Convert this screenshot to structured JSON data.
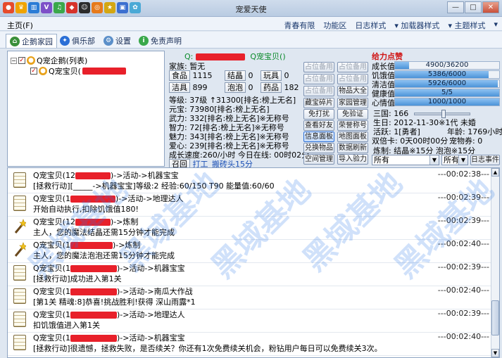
{
  "window": {
    "title": "宠爱天使",
    "controls": [
      "—",
      "□",
      "✕"
    ]
  },
  "menu": {
    "home": "主页(F)",
    "right": [
      "青春有限",
      "功能区",
      "日志样式",
      "▾ 加载器样式",
      "▾ 主题样式",
      "▾"
    ]
  },
  "tabs": [
    {
      "label": "企鹅家园",
      "icon": "home-icon"
    },
    {
      "label": "俱乐部",
      "icon": "club-icon"
    },
    {
      "label": "设置",
      "icon": "gear-icon"
    },
    {
      "label": "免责声明",
      "icon": "info-icon"
    }
  ],
  "tree": {
    "root_label": "Q宠企鹅(列表)",
    "child_label": "Q宠宝贝("
  },
  "pet": {
    "header_q": "Q:",
    "header_pet": "Q宠宝贝()",
    "family_label": "家族:",
    "family_value": "暂无",
    "food_label": "食品",
    "food_value": "1115",
    "crystal_label": "结晶",
    "crystal_value": "0",
    "toy_label": "玩具",
    "toy_value": "0",
    "clean_label": "洁具",
    "clean_value": "899",
    "bubble_label": "泡泡",
    "bubble_value": "0",
    "medicine_label": "药品",
    "medicine_value": "182",
    "level": "等级: 37级 ↑31300[排名:榜上无名]",
    "yuanbao": "元宝: 73980[排名:榜上无名]",
    "force": "武力: 332[排名:榜上无名]※无称号",
    "wisdom": "智力: 72[排名:榜上无名]※无称号",
    "charm": "魅力: 343[排名:榜上无名]※无称号",
    "love": "爱心: 239[排名:榜上无名]※无称号",
    "growth_speed": "成长速度:260/小时   今日在线: 00时02分",
    "recall_label": "召回",
    "work_link": "打工_搬砖头15分"
  },
  "buttons": [
    [
      "占位备用",
      "占位备用"
    ],
    [
      "占位备用",
      "占位备用"
    ],
    [
      "占位备用",
      "物品大全"
    ],
    [
      "藏宝碎片",
      "家园管理"
    ],
    [
      "免打扰",
      "免验证"
    ],
    [
      "查看好友",
      "荣誉称号"
    ],
    [
      "信息面板",
      "地图面板"
    ],
    [
      "兑换物品",
      "数据刷新"
    ],
    [
      "空间管理",
      "导入验力"
    ]
  ],
  "stats": {
    "title": "给力点赞",
    "bars": [
      {
        "label": "成长值",
        "text": "4900/36200",
        "fraction": 0.135
      },
      {
        "label": "饥饿值",
        "text": "5386/6000",
        "fraction": 0.898
      },
      {
        "label": "清洁值",
        "text": "5926/6000",
        "fraction": 0.988
      },
      {
        "label": "健康值",
        "text": "5/5",
        "fraction": 1.0
      },
      {
        "label": "心情值",
        "text": "1000/1000",
        "fraction": 1.0
      }
    ],
    "sanguo": "三国: 166",
    "birth": "生日: 2012-11-30※1代 未婚",
    "activity": "活跃: 1[勇者]",
    "age": "年龄: 1769小时",
    "double_card": "双倍卡: 0天00时00分",
    "pet_items": "宠物券: 0",
    "refine": "炼制: 结晶※15分 泡泡※15分"
  },
  "filters": {
    "first": "所有",
    "second": "所有",
    "log_button": "日志事件"
  },
  "log": [
    {
      "icon": "note",
      "l1_pre": "Q宠宝贝(12",
      "l1_post": ")->活动->机器宝宝",
      "l2": "[拯救行动][_____->机器宝宝]等级:2 经验:60/150 T90 能量值:60/60",
      "time": "---00:02:38---"
    },
    {
      "icon": "note",
      "l1_pre": "Q宠宝贝(1",
      "l1_post": ")->活动->地理达人",
      "l2": "开始自动执行,扣除饥饿值180!",
      "time": "---00:02:39---"
    },
    {
      "icon": "wand",
      "l1_pre": "Q宠宝贝(12",
      "l1_post": ")->炼制",
      "l2": "主人，您的魔法结晶还需15分钟才能完成",
      "time": "---00:02:39---"
    },
    {
      "icon": "wand",
      "l1_pre": "Q宠宝贝(1",
      "l1_post": ")->炼制",
      "l2": "主人，您的魔法泡泡还需15分钟才能完成",
      "time": "---00:02:40---"
    },
    {
      "icon": "note",
      "l1_pre": "Q宠宝贝(1",
      "l1_post": ")->活动->机器宝宝",
      "l2": "[拯救行动]成功进入第1关",
      "time": "---00:02:39---"
    },
    {
      "icon": "note",
      "l1_pre": "Q宠宝贝(1",
      "l1_post": ")->活动->南瓜大作战",
      "l2": "[第1关 精魂:8]恭喜!挑战胜利!获得 深山雨露*1",
      "time": "---00:02:40---"
    },
    {
      "icon": "note",
      "l1_pre": "Q宠宝贝(1",
      "l1_post": ")->活动->地理达人",
      "l2": "扣饥饿值进入第1关",
      "time": "---00:02:39---"
    },
    {
      "icon": "note",
      "l1_pre": "Q宠宝贝(1",
      "l1_post": ")->活动->机器宝宝",
      "l2": "[拯救行动]很遗憾，拯救失败，是否续关？你还有1次免费续关机会，粉钻用户每日可以免费续关3次。",
      "time": "---00:02:40---"
    }
  ],
  "watermark": "黑域基地",
  "colors": {
    "accent": "#2b6fd6",
    "redact": "#e8202a",
    "green": "#0a8a2a",
    "stats_title": "#d01515"
  }
}
